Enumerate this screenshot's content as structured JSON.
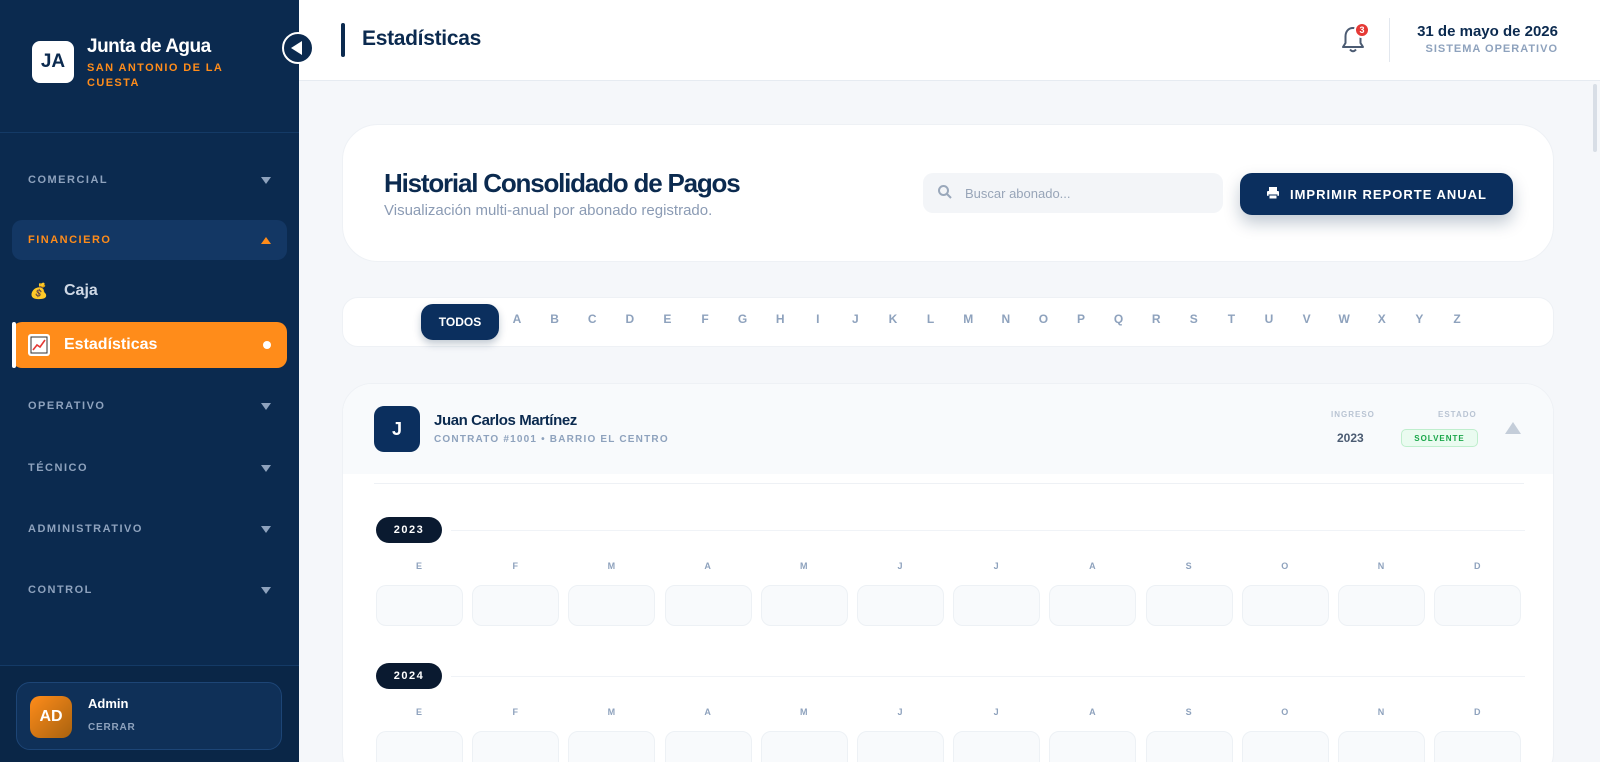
{
  "brand": {
    "initials": "JA",
    "title": "Junta de Agua",
    "subtitle": "SAN ANTONIO DE LA CUESTA"
  },
  "sidebar": {
    "sections": [
      {
        "label": "COMERCIAL"
      },
      {
        "label": "FINANCIERO"
      },
      {
        "label": "OPERATIVO"
      },
      {
        "label": "TÉCNICO"
      },
      {
        "label": "ADMINISTRATIVO"
      },
      {
        "label": "CONTROL"
      }
    ],
    "items": [
      {
        "label": "Caja",
        "icon": "money-bag-icon"
      },
      {
        "label": "Estadísticas",
        "icon": "chart-icon"
      }
    ]
  },
  "user": {
    "initials": "AD",
    "name": "Admin",
    "logout": "CERRAR"
  },
  "header": {
    "title": "Estadísticas",
    "notifications": "3",
    "date": "31 de mayo de 2026",
    "status": "SISTEMA OPERATIVO"
  },
  "hero": {
    "title": "Historial Consolidado de Pagos",
    "subtitle": "Visualización multi-anual por abonado registrado.",
    "search_placeholder": "Buscar abonado...",
    "print_label": "IMPRIMIR REPORTE ANUAL"
  },
  "filter": {
    "all_label": "TODOS",
    "letters": [
      "A",
      "B",
      "C",
      "D",
      "E",
      "F",
      "G",
      "H",
      "I",
      "J",
      "K",
      "L",
      "M",
      "N",
      "O",
      "P",
      "Q",
      "R",
      "S",
      "T",
      "U",
      "V",
      "W",
      "X",
      "Y",
      "Z"
    ]
  },
  "record": {
    "initial": "J",
    "name": "Juan Carlos Martínez",
    "meta": "CONTRATO #1001 • BARRIO EL CENTRO",
    "ingreso_label": "INGRESO",
    "ingreso_value": "2023",
    "estado_label": "ESTADO",
    "estado_value": "SOLVENTE",
    "years": [
      {
        "year": "2023",
        "months": [
          "E",
          "F",
          "M",
          "A",
          "M",
          "J",
          "J",
          "A",
          "S",
          "O",
          "N",
          "D"
        ]
      },
      {
        "year": "2024",
        "months": [
          "E",
          "F",
          "M",
          "A",
          "M",
          "J",
          "J",
          "A",
          "S",
          "O",
          "N",
          "D"
        ]
      }
    ]
  },
  "colors": {
    "navy": "#0b2a4f",
    "accent": "#ff8c1a",
    "success": "#1aa64a"
  }
}
